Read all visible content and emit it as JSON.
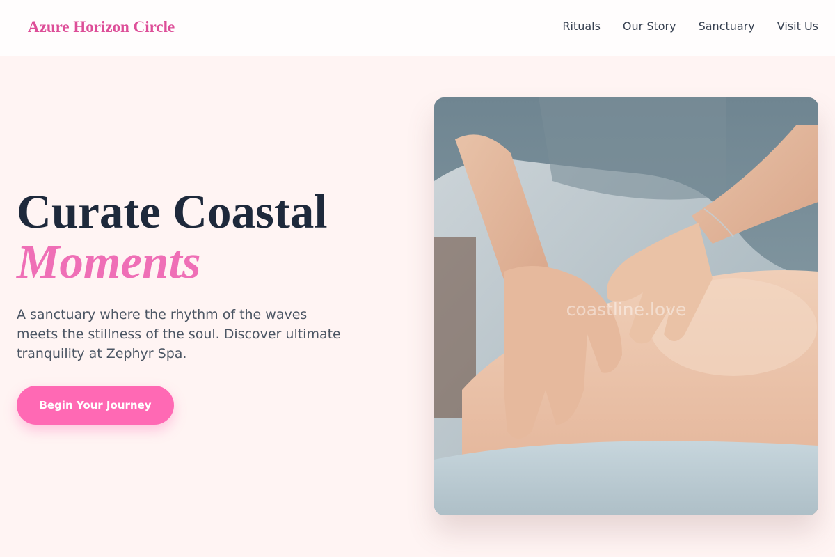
{
  "header": {
    "brand": "Azure Horizon Circle",
    "nav": [
      "Rituals",
      "Our Story",
      "Sanctuary",
      "Visit Us"
    ]
  },
  "hero": {
    "title_line1": "Curate Coastal",
    "title_line2": "Moments",
    "description": "A sanctuary where the rhythm of the waves meets the stillness of the soul. Discover ultimate tranquility at Zephyr Spa.",
    "cta_label": "Begin Your Journey"
  },
  "image": {
    "alt": "Therapist giving a back massage",
    "watermark": "coastline.love"
  },
  "colors": {
    "accent": "#ff69b4",
    "brand": "#dd4e98",
    "background": "#fff4f3",
    "heading": "#1e293b"
  }
}
